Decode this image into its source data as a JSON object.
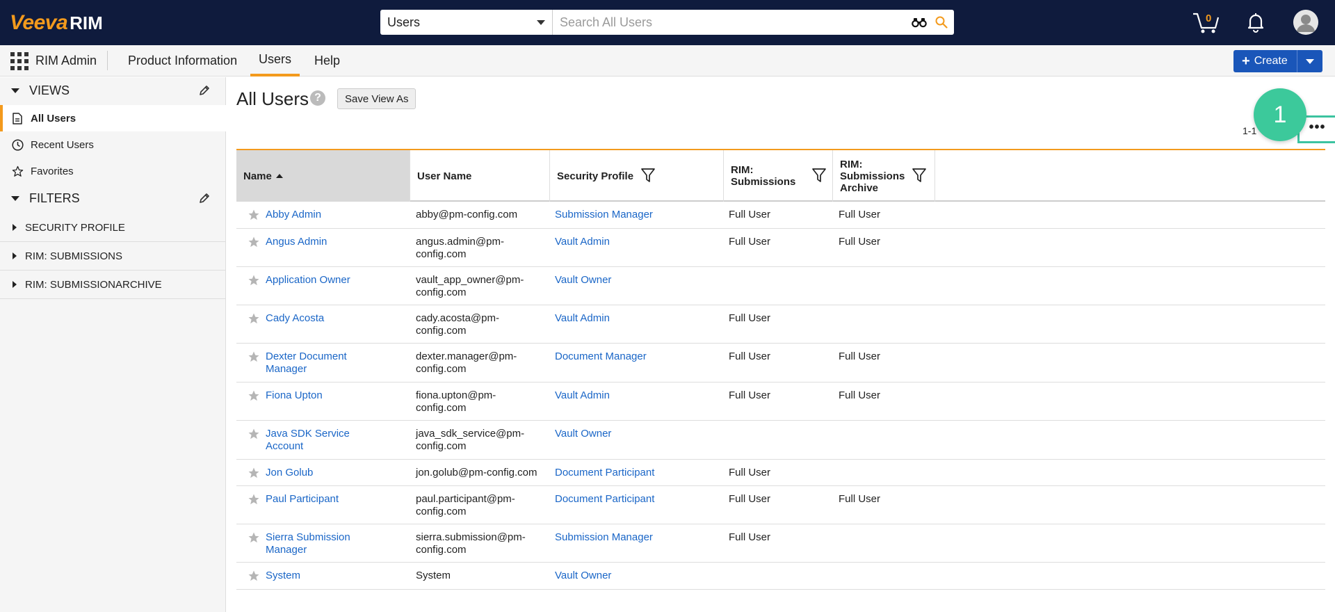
{
  "header": {
    "logo_brand": "Veeva",
    "logo_product": "RIM",
    "search_scope": "Users",
    "search_placeholder": "Search All Users",
    "cart_count": "0"
  },
  "nav": {
    "app_name": "RIM Admin",
    "tabs": [
      {
        "label": "Product Information"
      },
      {
        "label": "Users"
      },
      {
        "label": "Help"
      }
    ],
    "active_tab": "Users",
    "create_label": "Create"
  },
  "sidebar": {
    "views_title": "VIEWS",
    "views": [
      {
        "label": "All Users"
      },
      {
        "label": "Recent Users"
      },
      {
        "label": "Favorites"
      }
    ],
    "filters_title": "FILTERS",
    "filters": [
      {
        "label": "SECURITY PROFILE"
      },
      {
        "label": "RIM: SUBMISSIONS"
      },
      {
        "label": "RIM: SUBMISSIONARCHIVE"
      }
    ]
  },
  "main": {
    "title": "All Users",
    "help_glyph": "?",
    "save_view_label": "Save View As",
    "pagination": "1-1",
    "more_glyph": "•••",
    "callout_number": "1",
    "columns": [
      {
        "label": "Name"
      },
      {
        "label": "User Name"
      },
      {
        "label": "Security Profile"
      },
      {
        "label": "RIM: Submissions"
      },
      {
        "label": "RIM: Submissions Archive"
      }
    ],
    "rows": [
      {
        "name": "Abby Admin",
        "username": "abby@pm-config.com",
        "profile": "Submission Manager",
        "sub": "Full User",
        "arch": "Full User"
      },
      {
        "name": "Angus Admin",
        "username": "angus.admin@pm-config.com",
        "profile": "Vault Admin",
        "sub": "Full User",
        "arch": "Full User"
      },
      {
        "name": "Application Owner",
        "username": "vault_app_owner@pm-config.com",
        "profile": "Vault Owner",
        "sub": "",
        "arch": ""
      },
      {
        "name": "Cady Acosta",
        "username": "cady.acosta@pm-config.com",
        "profile": "Vault Admin",
        "sub": "Full User",
        "arch": ""
      },
      {
        "name": "Dexter Document Manager",
        "username": "dexter.manager@pm-config.com",
        "profile": "Document Manager",
        "sub": "Full User",
        "arch": "Full User"
      },
      {
        "name": "Fiona Upton",
        "username": "fiona.upton@pm-config.com",
        "profile": "Vault Admin",
        "sub": "Full User",
        "arch": "Full User"
      },
      {
        "name": "Java SDK Service Account",
        "username": "java_sdk_service@pm-config.com",
        "profile": "Vault Owner",
        "sub": "",
        "arch": ""
      },
      {
        "name": "Jon Golub",
        "username": "jon.golub@pm-config.com",
        "profile": "Document Participant",
        "sub": "Full User",
        "arch": ""
      },
      {
        "name": "Paul Participant",
        "username": "paul.participant@pm-config.com",
        "profile": "Document Participant",
        "sub": "Full User",
        "arch": "Full User"
      },
      {
        "name": "Sierra Submission Manager",
        "username": "sierra.submission@pm-config.com",
        "profile": "Submission Manager",
        "sub": "Full User",
        "arch": ""
      },
      {
        "name": "System",
        "username": "System",
        "profile": "Vault Owner",
        "sub": "",
        "arch": ""
      }
    ]
  },
  "colors": {
    "topbar": "#0f1b3d",
    "accent": "#f39a1d",
    "link": "#1a66c7",
    "create": "#1a56b9",
    "callout": "#3cc99b"
  }
}
